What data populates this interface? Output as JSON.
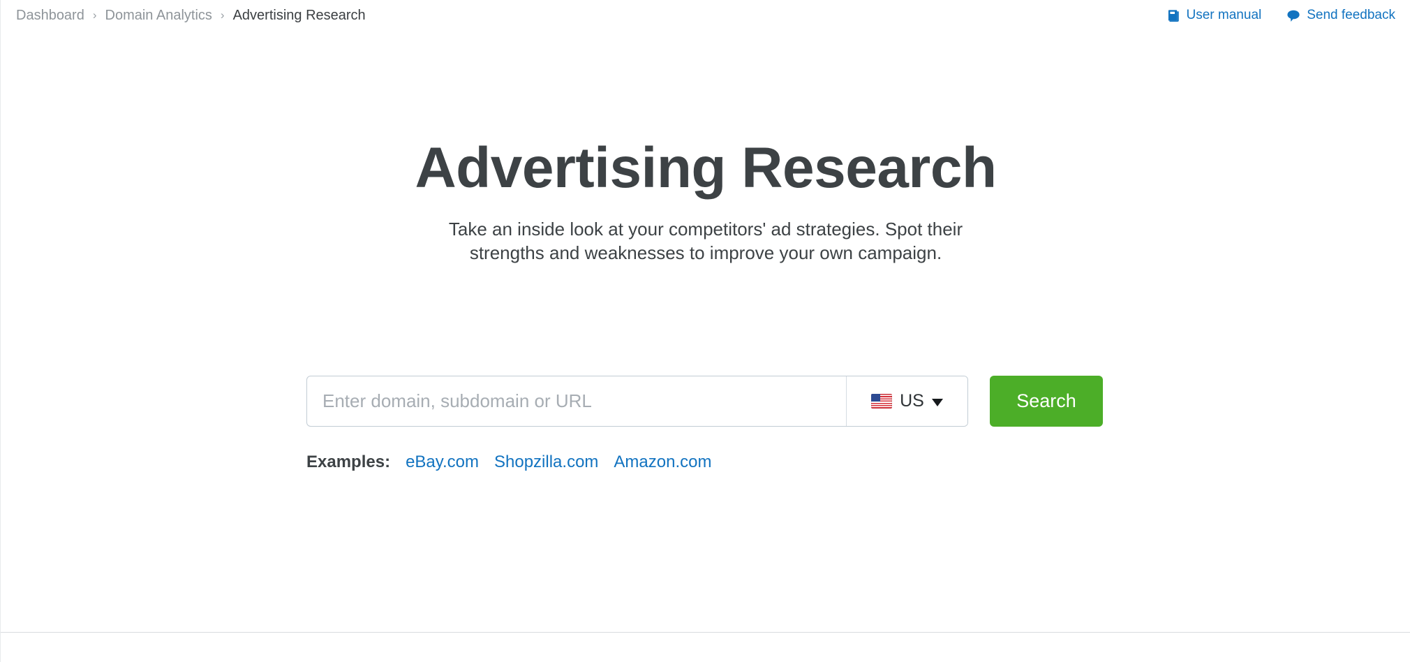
{
  "breadcrumb": {
    "separator": "›",
    "items": [
      {
        "label": "Dashboard",
        "current": false
      },
      {
        "label": "Domain Analytics",
        "current": false
      },
      {
        "label": "Advertising Research",
        "current": true
      }
    ]
  },
  "top_links": [
    {
      "label": "User manual",
      "icon": "book-icon"
    },
    {
      "label": "Send feedback",
      "icon": "speech-bubble-icon"
    }
  ],
  "hero": {
    "title": "Advertising Research",
    "subtitle": "Take an inside look at your competitors' ad strategies. Spot their strengths and weaknesses to improve your own campaign."
  },
  "search": {
    "placeholder": "Enter domain, subdomain or URL",
    "value": "",
    "country": {
      "code": "US",
      "flag": "us-flag-icon",
      "chevron": "chevron-down-icon"
    },
    "button_label": "Search"
  },
  "examples": {
    "label": "Examples:",
    "links": [
      "eBay.com",
      "Shopzilla.com",
      "Amazon.com"
    ]
  },
  "colors": {
    "accent_blue": "#1273c0",
    "button_green": "#4cae28",
    "text_dark": "#3d4245",
    "text_muted": "#8e9499",
    "border": "#c2ccd4",
    "divider": "#d9dcde"
  }
}
